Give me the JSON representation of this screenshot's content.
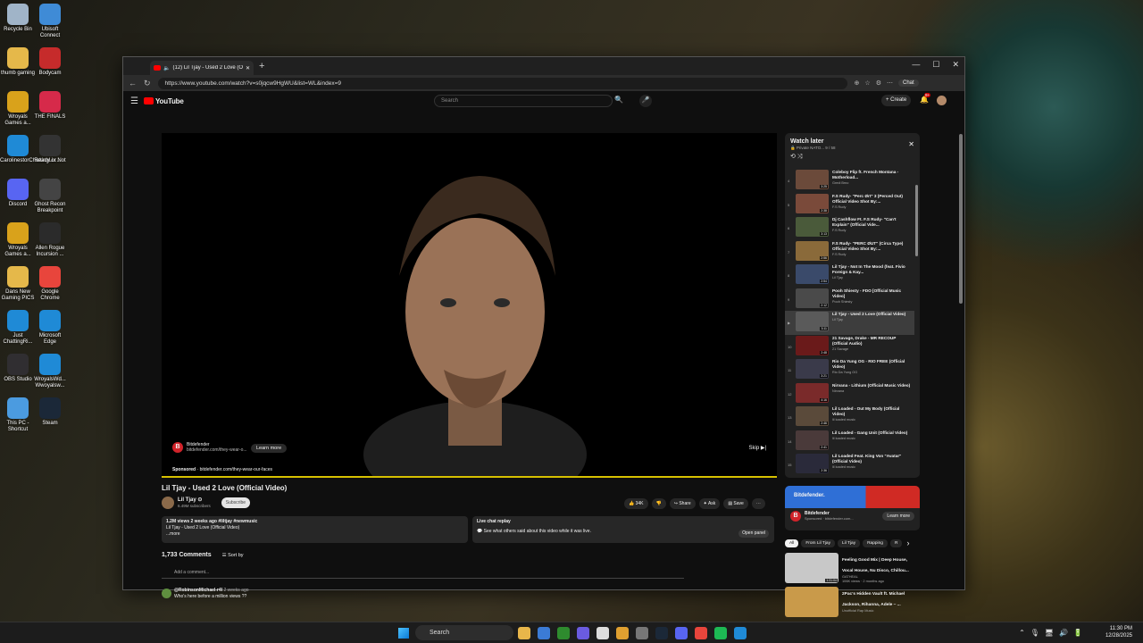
{
  "desktop": {
    "icons": [
      {
        "label": "Recycle Bin",
        "color": "#a0b4c8"
      },
      {
        "label": "Ubisoft Connect",
        "color": "#3f8bd6"
      },
      {
        "label": "thumb gaming",
        "color": "#e5b84a"
      },
      {
        "label": "Bodycam",
        "color": "#c62b2b"
      },
      {
        "label": "Wroyals Games a...",
        "color": "#d9a21b"
      },
      {
        "label": "THE FINALS",
        "color": "#d62a4a"
      },
      {
        "label": "CarolinestorChattingLiv...",
        "color": "#1f8ad6"
      },
      {
        "label": "Ready or Not",
        "color": "#333"
      },
      {
        "label": "Discord",
        "color": "#5865f2"
      },
      {
        "label": "Ghost Recon Breakpoint",
        "color": "#444"
      },
      {
        "label": "Wroyals Games a...",
        "color": "#d9a21b"
      },
      {
        "label": "Allen Rogue Incursion ...",
        "color": "#2b2b2b"
      },
      {
        "label": "Dans New Gaming PICS",
        "color": "#e5b84a"
      },
      {
        "label": "Google Chrome",
        "color": "#e8453c"
      },
      {
        "label": "Just ChattingRi...",
        "color": "#1f8ad6"
      },
      {
        "label": "Microsoft Edge",
        "color": "#1f8ad6"
      },
      {
        "label": "OBS Studio",
        "color": "#302e31"
      },
      {
        "label": "WroyalsWd... Wwoyalsw...",
        "color": "#1f8ad6"
      },
      {
        "label": "This PC - Shortcut",
        "color": "#4b9be0"
      },
      {
        "label": "Steam",
        "color": "#1b2838"
      }
    ]
  },
  "browser": {
    "tab_title": "(12) Lil Tjay - Used 2 Love (Offi",
    "url": "https://www.youtube.com/watch?v=s0jqcw9HgWU&list=WL&index=9",
    "chat_label": "Chat"
  },
  "youtube": {
    "logo_text": "YouTube",
    "search_placeholder": "Search",
    "create_label": "+ Create",
    "notif_count": "9+"
  },
  "player": {
    "ad_brand": "Bitdefender",
    "ad_domain": "bitdefender.com/they-wear-o...",
    "learn_more": "Learn more",
    "sponsored": "Sponsored",
    "sponsored_url": "bitdefender.com/they-wear-our-faces",
    "skip": "Skip ▶|",
    "progress": 1.0
  },
  "video": {
    "title": "Lil Tjay - Used 2 Love (Official Video)",
    "channel": "Lil Tjay ⊙",
    "subscribers": "6.49M subscribers",
    "subscribe": "Subscribe",
    "actions": {
      "likes": "👍 34K",
      "dislike": "👎",
      "share": "↪ Share",
      "ask": "✦ Ask",
      "save": "▤ Save",
      "more": "⋯"
    },
    "desc_stats": "1.2M views  2 weeks ago  #liltjay #newmusic",
    "desc_line": "Lil Tjay - Used 2 Love (Official Video)",
    "desc_more": "...more",
    "chat_replay_title": "Live chat replay",
    "chat_replay_text": "See what others said about this video while it was live.",
    "open_panel": "Open panel"
  },
  "comments": {
    "count": "1,733 Comments",
    "sort": "☰ Sort by",
    "add": "Add a comment...",
    "first": {
      "author": "@RobinsonMichael-r4l",
      "time": "2 weeks ago",
      "text": "Who's here before a million views ??"
    }
  },
  "watch_later": {
    "title": "Watch later",
    "sub": "🔒 Private  NATO...  9 / 58",
    "controls": "⟲  ⤨",
    "items": [
      {
        "n": "4",
        "title": "Coleboy Flip ft. French Montana - Motherload...",
        "channel": "Gredi Brno",
        "dur": "3:25",
        "color": "#6b4a3a"
      },
      {
        "n": "5",
        "title": "F.S Rudy- \"Perc Ørt\" 3 (Perced Out) Official Video Shot By:...",
        "channel": "F.S Rudy",
        "dur": "2:38",
        "color": "#7a4a3a"
      },
      {
        "n": "6",
        "title": "Dj Cashflow Ft. F.S Rudy- \"Can't Explain\" (Official Vide...",
        "channel": "F.S Rudy",
        "dur": "3:13",
        "color": "#4a5a3a"
      },
      {
        "n": "7",
        "title": "F.S Rudy- \"PERC ØUT\" (Circa Type) Official Video Shot By:...",
        "channel": "F.S Rudy",
        "dur": "2:56",
        "color": "#8a6a3a"
      },
      {
        "n": "8",
        "title": "Lil Tjay - Not In The Mood (feat. Fivio Foreign & Kay...",
        "channel": "Lil Tjay",
        "dur": "2:54",
        "color": "#3a4a6a"
      },
      {
        "n": "9",
        "title": "Pooh Shiesty - FDO [Official Music Video]",
        "channel": "Pooh Shiesty",
        "dur": "2:12",
        "color": "#4a4a4a"
      },
      {
        "n": "▶",
        "title": "Lil Tjay - Used 2 Love (Official Video)",
        "channel": "Lil Tjay",
        "dur": "3:11",
        "color": "#5a5a5a"
      },
      {
        "n": "10",
        "title": "21 Savage, Drake - MR RECOUP (Official Audio)",
        "channel": "21 Savage",
        "dur": "2:48",
        "color": "#6a1a1a"
      },
      {
        "n": "11",
        "title": "Rio Da Yung OG - RIO FREE (Official Video)",
        "channel": "Rio Da Yung OG",
        "dur": "3:21",
        "color": "#3a3a4a"
      },
      {
        "n": "12",
        "title": "Nirvana - Lithium (Official Music Video)",
        "channel": "Nirvana",
        "dur": "4:16",
        "color": "#7a2a2a"
      },
      {
        "n": "13",
        "title": "Lil Loaded - Out My Body (Official Video)",
        "channel": "lil loaded music",
        "dur": "2:46",
        "color": "#5a4a3a"
      },
      {
        "n": "14",
        "title": "Lil Loaded - Gang Unit (Official Video)",
        "channel": "lil loaded music",
        "dur": "2:41",
        "color": "#4a3a3a"
      },
      {
        "n": "15",
        "title": "Lil Loaded Feat. King Von \"Avatar\" (Official Video)",
        "channel": "lil loaded music",
        "dur": "2:36",
        "color": "#2a2a3a"
      }
    ]
  },
  "ad_card": {
    "banner": "Bitdefender.",
    "brand": "Bitdefender",
    "sponsored": "Sponsored · bitdefender.com...",
    "learn": "Learn more"
  },
  "chips": [
    "All",
    "From Lil Tjay",
    "Lil Tjay",
    "Rapping",
    "R"
  ],
  "recommended": [
    {
      "title": "Feeling Good Mix | Deep House, Vocal House, Nu Disco, Chillou...",
      "channel": "GATHEAL",
      "meta": "106K views · 2 months ago",
      "dur": "1:31:04",
      "color": "#c8c8c8"
    },
    {
      "title": "2Pac's Hidden Vault ft. Michael Jackson, Rihanna, Adele – ...",
      "channel": "Unofficial Rap Music",
      "meta": "",
      "dur": "",
      "color": "#c99a4a"
    }
  ],
  "taskbar": {
    "search": "Search",
    "time": "11:30 PM",
    "date": "12/28/2025"
  }
}
